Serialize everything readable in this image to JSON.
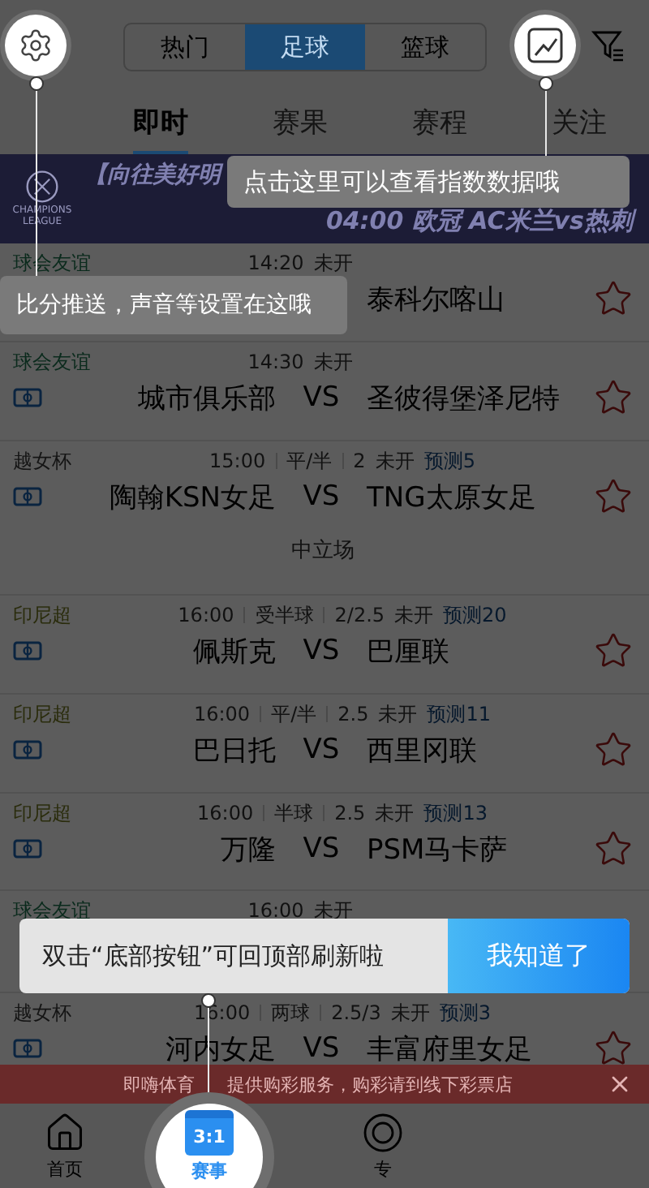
{
  "top_bar": {
    "segments": [
      {
        "label": "热门",
        "selected": false
      },
      {
        "label": "足球",
        "selected": true
      },
      {
        "label": "篮球",
        "selected": false
      }
    ]
  },
  "tabs": [
    {
      "label": "即时",
      "selected": true
    },
    {
      "label": "赛果",
      "selected": false
    },
    {
      "label": "赛程",
      "selected": false
    },
    {
      "label": "关注",
      "selected": false
    }
  ],
  "banner": {
    "logo_caption": "CHAMPIONS LEAGUE",
    "headline": "【向往美好明",
    "subline": "04:00 欧冠 AC米兰vs热刺"
  },
  "matches": [
    {
      "league": "球会友谊",
      "color": "#0a2a1c",
      "time": "14:20",
      "status": "未开",
      "away": "泰科尔喀山",
      "starred": false
    },
    {
      "league": "球会友谊",
      "color": "#0a2a1c",
      "time": "14:30",
      "status": "未开",
      "home": "城市俱乐部",
      "vs": "VS",
      "away": "圣彼得堡泽尼特",
      "starred": false
    },
    {
      "league": "越女杯",
      "color": "#141414",
      "time": "15:00",
      "handicap": "平/半",
      "line": "2",
      "status": "未开",
      "prediction": "预测5",
      "home": "陶翰KSN女足",
      "vs": "VS",
      "away": "TNG太原女足",
      "note": "中立场",
      "starred": false
    },
    {
      "league": "印尼超",
      "color": "#2a2c0c",
      "time": "16:00",
      "handicap": "受半球",
      "line": "2/2.5",
      "status": "未开",
      "prediction": "预测20",
      "home": "佩斯克",
      "vs": "VS",
      "away": "巴厘联",
      "starred": false
    },
    {
      "league": "印尼超",
      "color": "#2a2c0c",
      "time": "16:00",
      "handicap": "平/半",
      "line": "2.5",
      "status": "未开",
      "prediction": "预测11",
      "home": "巴日托",
      "vs": "VS",
      "away": "西里冈联",
      "starred": false
    },
    {
      "league": "印尼超",
      "color": "#2a2c0c",
      "time": "16:00",
      "handicap": "半球",
      "line": "2.5",
      "status": "未开",
      "prediction": "预测13",
      "home": "万隆",
      "vs": "VS",
      "away": "PSM马卡萨",
      "starred": false
    },
    {
      "league": "球会友谊",
      "color": "#0a2a1c",
      "time": "16:00",
      "status": "未开"
    },
    {
      "league": "越女杯",
      "color": "#141414",
      "time": "16:00",
      "handicap": "两球",
      "line": "2.5/3",
      "status": "未开",
      "prediction": "预测3",
      "home": "河内女足",
      "vs": "VS",
      "away": "丰富府里女足",
      "starred": false
    }
  ],
  "notice": {
    "text_before": "即嗨体育",
    "text_after": "提供购彩服务，购彩请到线下彩票店"
  },
  "bottom_nav": [
    {
      "label": "首页",
      "kind": "home",
      "selected": false
    },
    {
      "label": "赛事",
      "kind": "calendar",
      "icon_text": "3:1",
      "selected": true
    },
    {
      "label": "专",
      "kind": "expert",
      "selected": false
    }
  ],
  "guide": {
    "index_tip": "点击这里可以查看指数数据哦",
    "settings_tip": "比分推送，声音等设置在这哦",
    "bottom_tip": "双击“底部按钮”可回顶部刷新啦",
    "confirm_button": "我知道了"
  }
}
